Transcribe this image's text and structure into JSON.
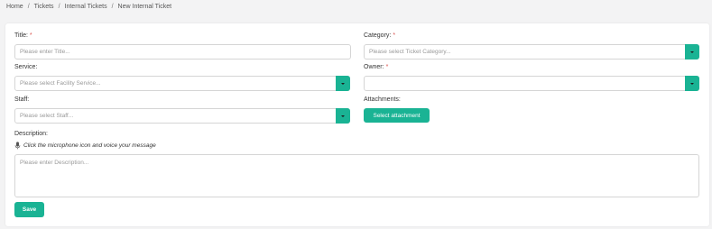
{
  "breadcrumb": {
    "items": [
      "Home",
      "Tickets",
      "Internal Tickets",
      "New Internal Ticket"
    ],
    "separator": "/"
  },
  "form": {
    "title": {
      "label": "Title:",
      "required_mark": "*",
      "placeholder": "Please enter Title..."
    },
    "category": {
      "label": "Category:",
      "required_mark": "*",
      "placeholder": "Please select Ticket Category..."
    },
    "service": {
      "label": "Service:",
      "placeholder": "Please select Facility Service..."
    },
    "owner": {
      "label": "Owner:",
      "required_mark": "*",
      "placeholder": ""
    },
    "staff": {
      "label": "Staff:",
      "placeholder": "Please select Staff..."
    },
    "attachments": {
      "label": "Attachments:",
      "button_label": "Select attachment"
    },
    "description": {
      "label": "Description:",
      "mic_hint": "Click the microphone icon and voice your message",
      "placeholder": "Please enter Description..."
    },
    "save_label": "Save"
  },
  "icons": {
    "dropdown": "chevron-down-icon",
    "microphone": "microphone-icon"
  },
  "colors": {
    "accent": "#1ab394",
    "required": "#d9534f",
    "background": "#f3f3f4"
  }
}
